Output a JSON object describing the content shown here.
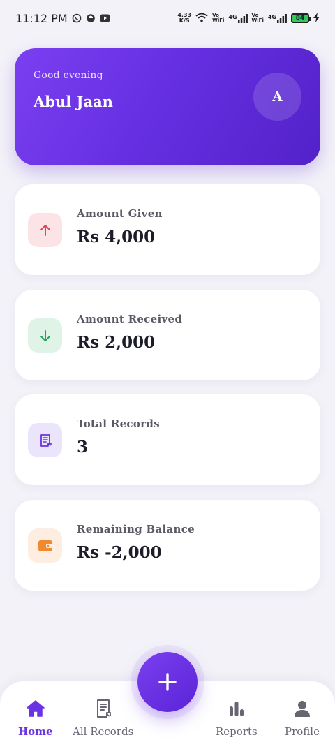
{
  "status_bar": {
    "time": "11:12 PM",
    "speed_value": "4.33",
    "speed_unit": "K/S",
    "net1_top": "Vo",
    "net1_bottom": "WiFi",
    "sig1": "4G",
    "net2_top": "Vo",
    "net2_bottom": "WiFi",
    "sig2": "4G",
    "battery": "84"
  },
  "header": {
    "greeting": "Good evening",
    "user_name": "Abul Jaan",
    "avatar_initial": "A"
  },
  "stats": [
    {
      "label": "Amount Given",
      "value": "Rs 4,000",
      "icon": "arrow-up-icon",
      "icon_bg": "#fce4e6",
      "icon_color": "#e0455a"
    },
    {
      "label": "Amount Received",
      "value": "Rs 2,000",
      "icon": "arrow-down-icon",
      "icon_bg": "#dff3e7",
      "icon_color": "#22a45d"
    },
    {
      "label": "Total Records",
      "value": "3",
      "icon": "receipt-icon",
      "icon_bg": "#ebe5fb",
      "icon_color": "#6a33e3"
    },
    {
      "label": "Remaining Balance",
      "value": "Rs -2,000",
      "icon": "wallet-icon",
      "icon_bg": "#fdeee1",
      "icon_color": "#f08a30"
    }
  ],
  "nav": {
    "home": "Home",
    "all_records": "All Records",
    "reports": "Reports",
    "profile": "Profile",
    "active": "home"
  },
  "colors": {
    "accent": "#6a33e3",
    "background": "#f3f2f8"
  }
}
